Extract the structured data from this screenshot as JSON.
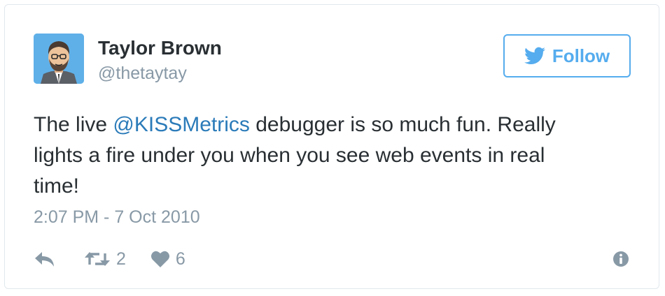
{
  "author": {
    "display_name": "Taylor Brown",
    "handle": "@thetaytay",
    "avatar_icon": "cartoon-avatar-icon"
  },
  "follow": {
    "label": "Follow",
    "icon": "twitter-bird-icon",
    "color": "#55acee"
  },
  "tweet": {
    "line1_before": "The live ",
    "mention": "@KISSMetrics",
    "line1_after": " debugger is so much fun. Really",
    "line2": "lights a fire under you when you see web events in real",
    "line3": "time!"
  },
  "timestamp": "2:07 PM - 7 Oct 2010",
  "actions": {
    "reply_icon": "reply-icon",
    "retweet_icon": "retweet-icon",
    "retweet_count": "2",
    "like_icon": "heart-icon",
    "like_count": "6",
    "info_icon": "info-icon"
  },
  "colors": {
    "text": "#292f33",
    "muted": "#8899a6",
    "link": "#2b7bb9",
    "border": "#e1e8ed"
  }
}
